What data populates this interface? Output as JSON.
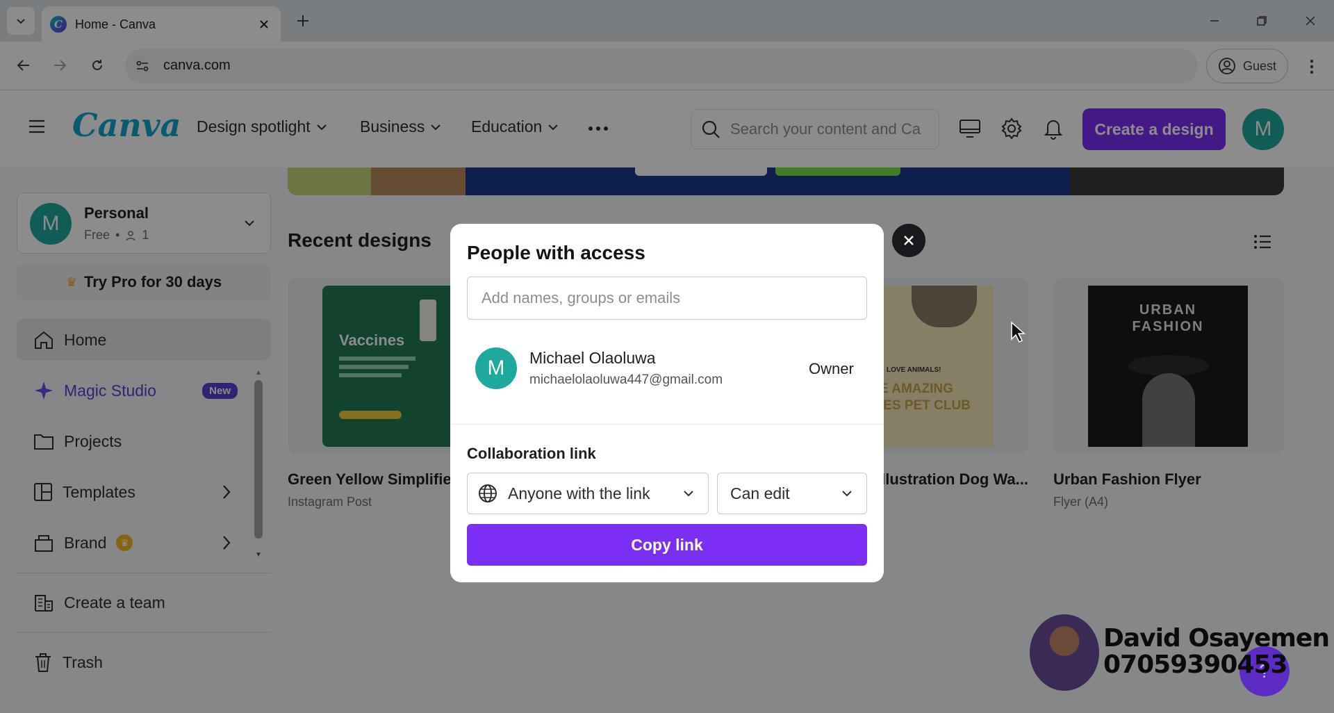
{
  "browser": {
    "tab_title": "Home - Canva",
    "url": "canva.com",
    "profile_label": "Guest"
  },
  "canva": {
    "logo": "Canva",
    "nav": [
      "Design spotlight",
      "Business",
      "Education"
    ],
    "search_placeholder": "Search your content and Ca",
    "create_button": "Create a design",
    "avatar_letter": "M",
    "account": {
      "name": "Personal",
      "plan": "Free",
      "members": "1",
      "avatar_letter": "M"
    },
    "try_pro": "Try Pro for 30 days",
    "sidebar": {
      "home": "Home",
      "magic_studio": "Magic Studio",
      "new_badge": "New",
      "projects": "Projects",
      "templates": "Templates",
      "brand": "Brand",
      "create_team": "Create a team",
      "trash": "Trash"
    },
    "recent_title": "Recent designs",
    "designs": [
      {
        "title": "Green Yellow Simplified",
        "type": "Instagram Post",
        "thumb_title": "Vaccines"
      },
      {
        "title": "Illustration Dog Wa...",
        "type": "",
        "thumb_text1": "LOVE ANIMALS!",
        "thumb_text2": "E AMAZING",
        "thumb_text3": "IES PET CLUB"
      },
      {
        "title": "Urban Fashion Flyer",
        "type": "Flyer (A4)",
        "thumb_text1": "URBAN",
        "thumb_text2": "FASHION"
      }
    ]
  },
  "modal": {
    "title": "People with access",
    "input_placeholder": "Add names, groups or emails",
    "owner": {
      "name": "Michael Olaoluwa",
      "email": "michaelolaoluwa447@gmail.com",
      "role": "Owner",
      "avatar_letter": "M"
    },
    "collab_label": "Collaboration link",
    "link_access": "Anyone with the link",
    "permission": "Can edit",
    "copy_button": "Copy link"
  },
  "watermark": {
    "name": "David Osayemen",
    "phone": "07059390453"
  },
  "help_button": "?",
  "colors": {
    "accent": "#7b2ff2",
    "avatar": "#1fa89e",
    "overlay": "rgba(0,0,0,0.45)"
  }
}
